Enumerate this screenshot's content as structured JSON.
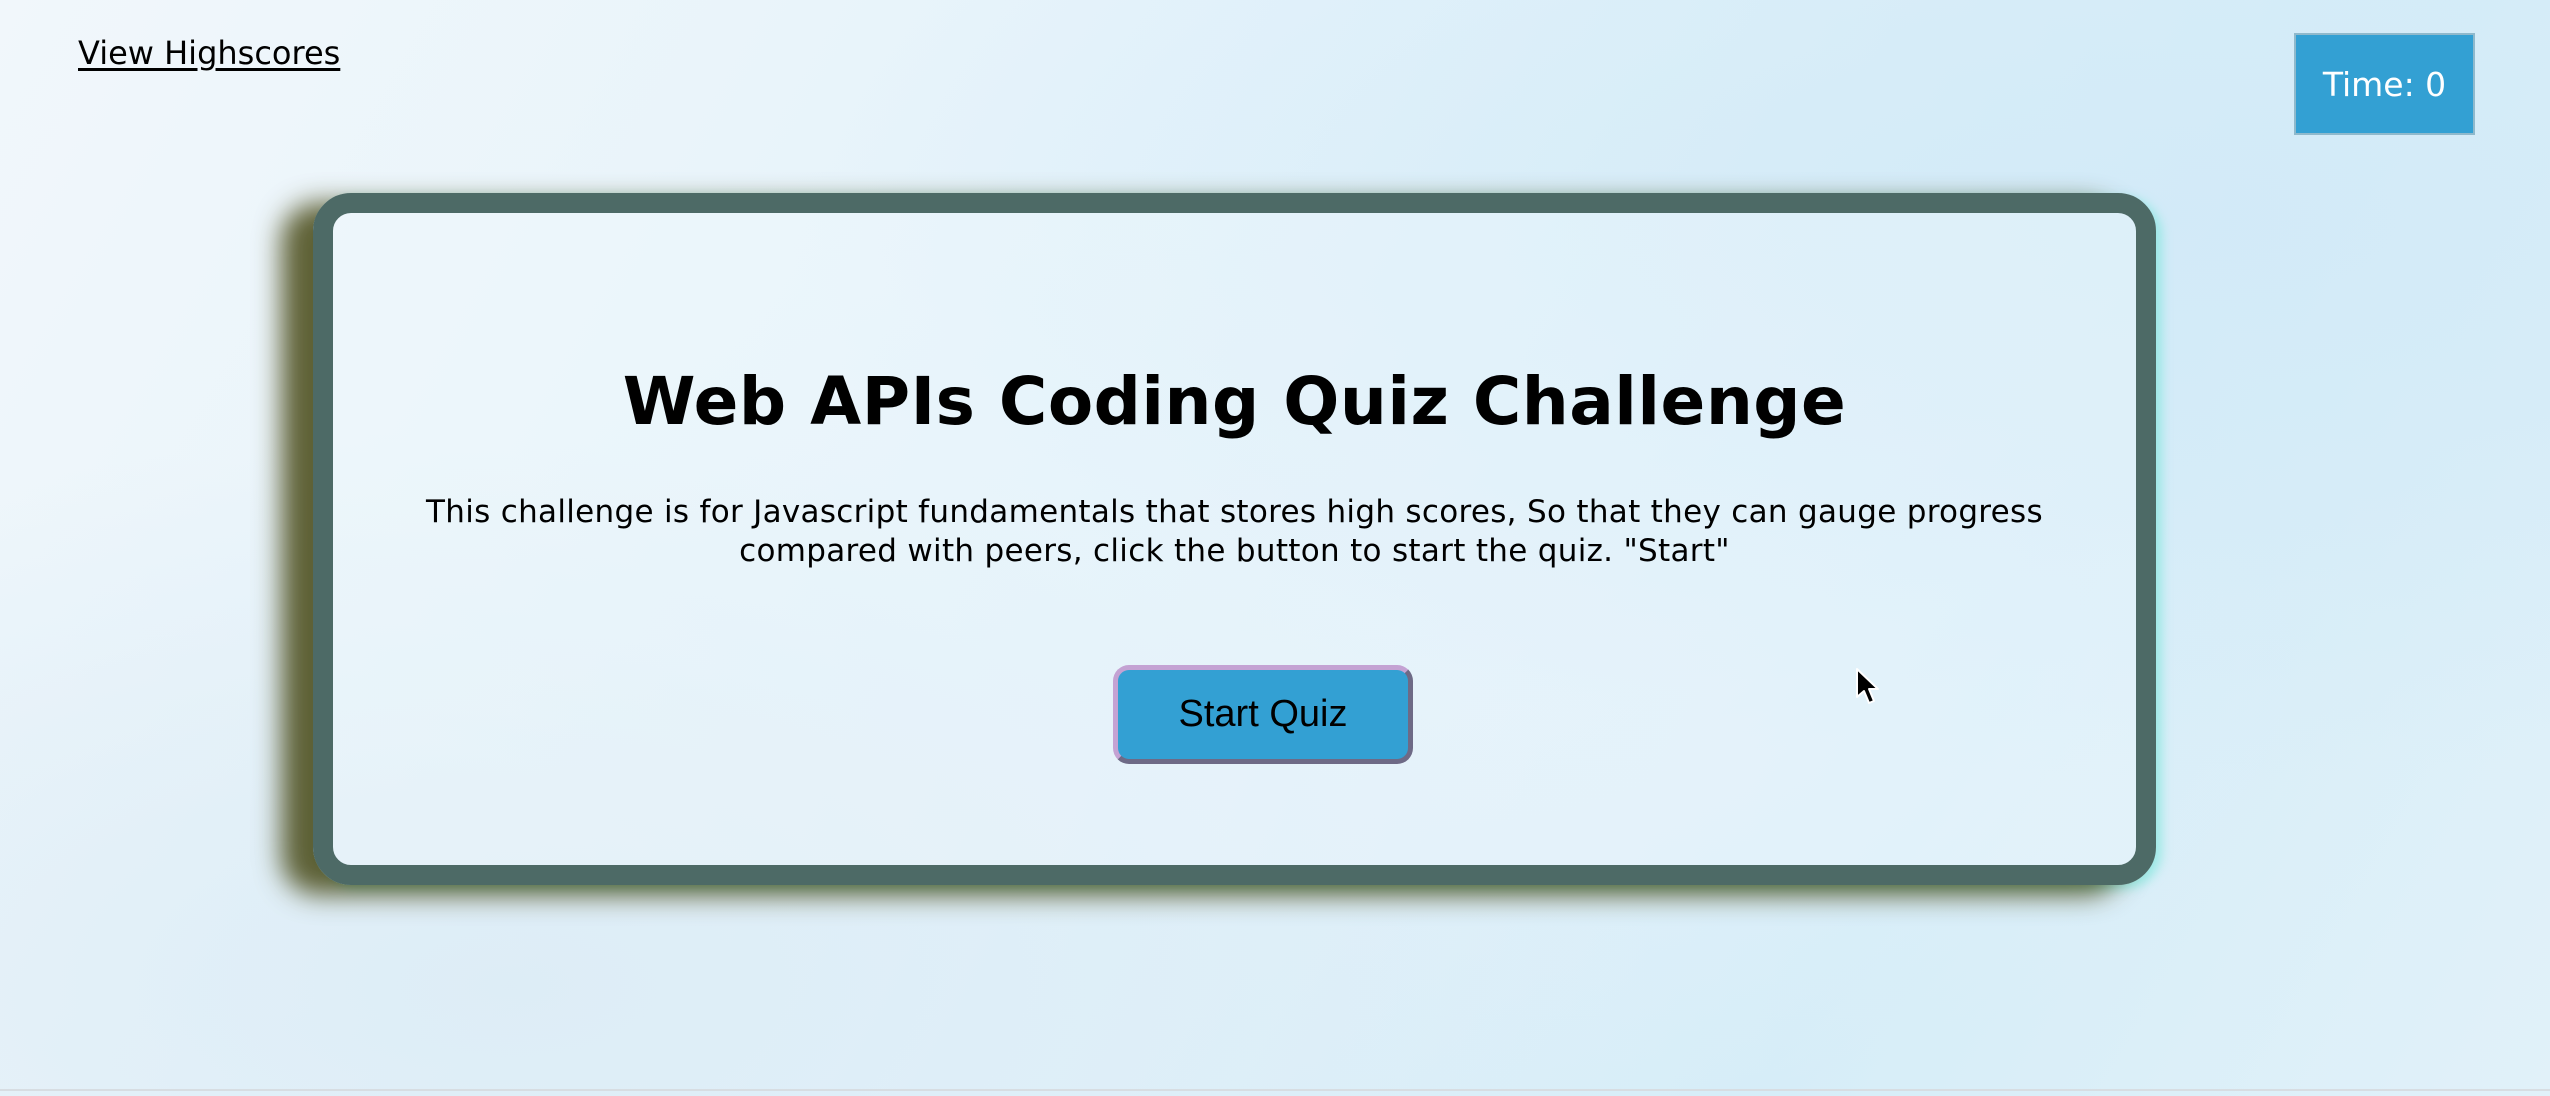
{
  "header": {
    "highscores_link": "View Highscores",
    "timer_text": "Time: 0"
  },
  "card": {
    "title": "Web APIs Coding Quiz Challenge",
    "description_line1": "This challenge is for Javascript fundamentals that stores high scores, So that they can gauge progress",
    "description_line2": "compared with peers, click the button to start the quiz. \"Start\"",
    "start_button_label": "Start Quiz"
  },
  "icons": {
    "cursor": "mouse-pointer-icon"
  },
  "colors": {
    "accent": "#33a0d3",
    "card_border": "#4d6a66",
    "timer_text": "#ffffff"
  }
}
